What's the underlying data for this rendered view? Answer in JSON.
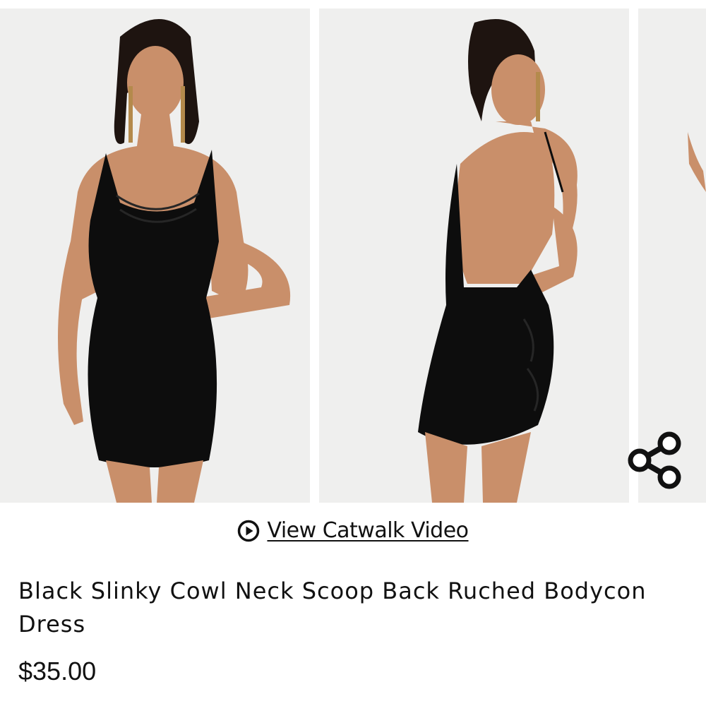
{
  "gallery": {
    "slides": [
      {
        "label": "front-view"
      },
      {
        "label": "back-view"
      },
      {
        "label": "side-view"
      }
    ]
  },
  "share": {
    "icon": "share-icon"
  },
  "catwalk": {
    "icon": "play-circle-icon",
    "label": "View Catwalk Video"
  },
  "product": {
    "title": "Black Slinky Cowl Neck Scoop Back Ruched Bodycon Dress",
    "price": "$35.00"
  },
  "colors": {
    "background": "#ffffff",
    "photo_backdrop": "#efefee",
    "text": "#111111",
    "dress": "#0d0d0d",
    "skin": "#c98f6a"
  }
}
